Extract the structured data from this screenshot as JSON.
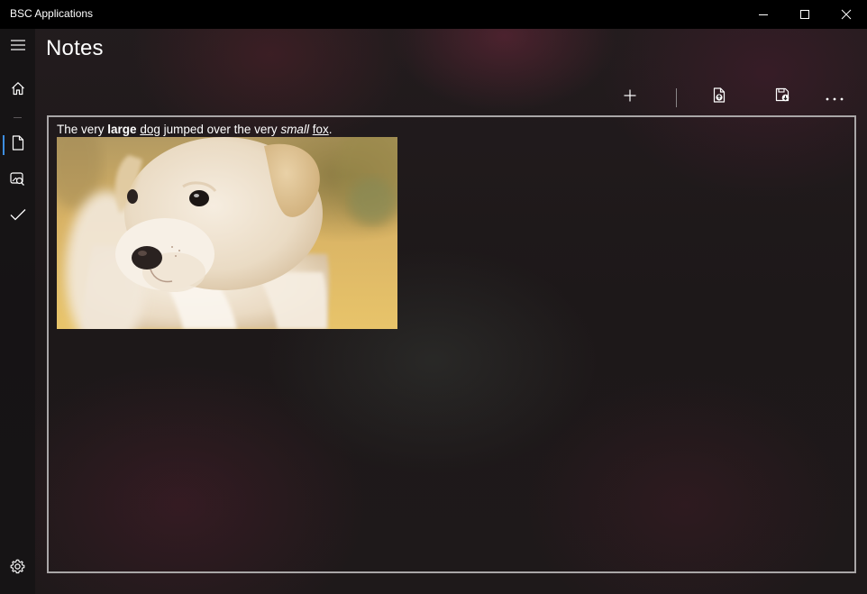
{
  "window": {
    "title": "BSC Applications"
  },
  "caption_buttons": {
    "minimize": "minimize-icon",
    "maximize": "maximize-icon",
    "close": "close-icon"
  },
  "nav": {
    "items": [
      {
        "icon": "hamburger-menu-icon"
      },
      {
        "icon": "home-icon"
      },
      {
        "icon": "document-icon",
        "selected": true
      },
      {
        "icon": "image-search-icon"
      },
      {
        "icon": "checkmark-icon"
      },
      {
        "icon": "gear-icon"
      }
    ],
    "accent_color": "#3d8ee0"
  },
  "page": {
    "title": "Notes"
  },
  "toolbar": {
    "items": [
      {
        "icon": "add-icon"
      },
      {
        "icon": "open-file-icon"
      },
      {
        "icon": "save-icon"
      },
      {
        "icon": "more-icon"
      }
    ]
  },
  "editor": {
    "segments": [
      {
        "text": "The very ",
        "style": "normal"
      },
      {
        "text": "large",
        "style": "bold"
      },
      {
        "text": " ",
        "style": "normal"
      },
      {
        "text": "dog",
        "style": "underline"
      },
      {
        "text": " jumped over the very ",
        "style": "normal"
      },
      {
        "text": "small",
        "style": "italic"
      },
      {
        "text": " ",
        "style": "normal"
      },
      {
        "text": "fox",
        "style": "underline"
      },
      {
        "text": ".",
        "style": "normal"
      }
    ],
    "image": {
      "subject": "puppy-photo"
    }
  }
}
